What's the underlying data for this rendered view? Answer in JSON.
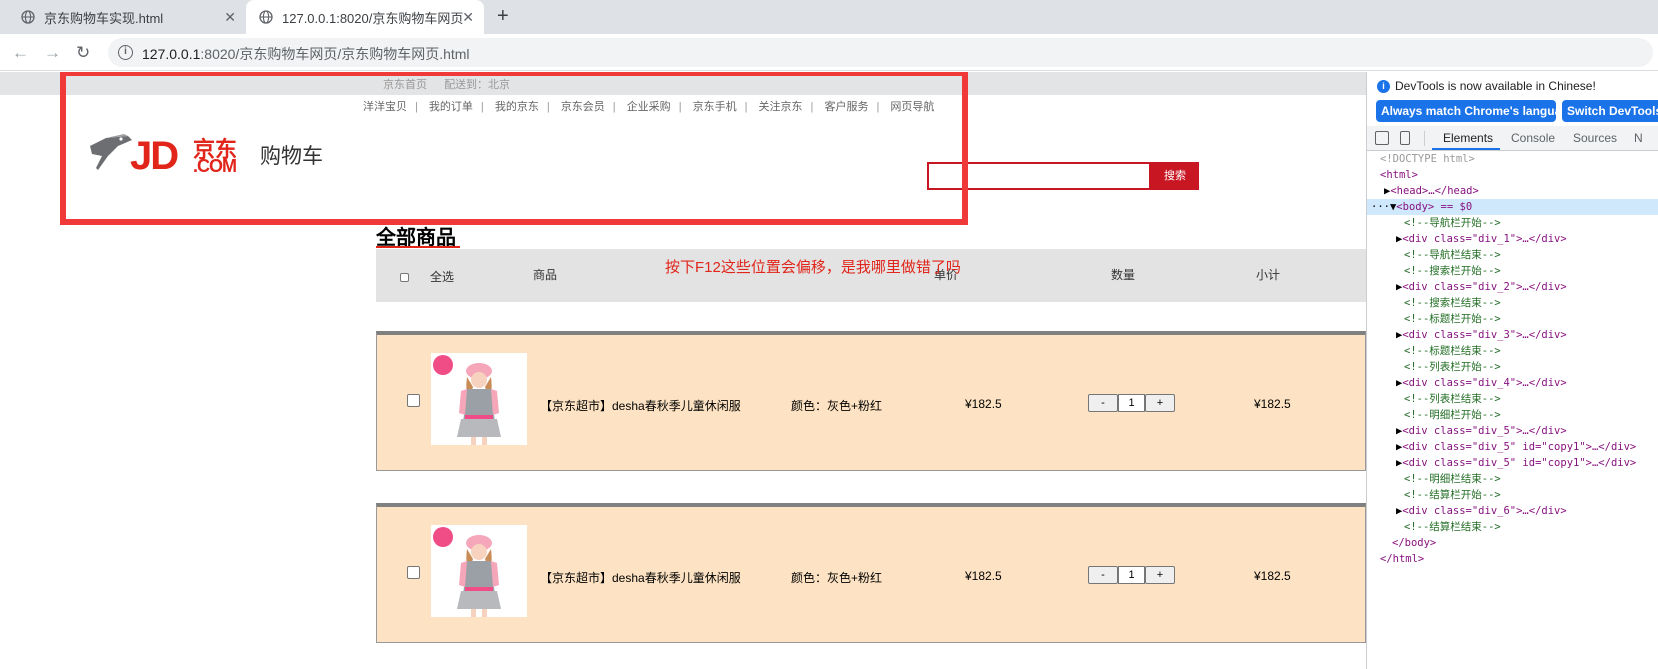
{
  "browser": {
    "tabs": [
      {
        "title": "京东购物车实现.html",
        "active": false
      },
      {
        "title": "127.0.0.1:8020/京东购物车网页",
        "active": true
      }
    ],
    "url_host": "127.0.0.1",
    "url_path": ":8020/京东购物车网页/京东购物车网页.html"
  },
  "page": {
    "topbar_links": [
      "京东首页",
      "配送到：北京"
    ],
    "shortcut_links": [
      "洋洋宝贝",
      "我的订单",
      "我的京东",
      "京东会员",
      "企业采购",
      "京东手机",
      "关注京东",
      "客户服务",
      "网页导航"
    ],
    "logo_jd": "JD",
    "logo_cn": "京东",
    "logo_com": ".COM",
    "cart_title": "购物车",
    "search_placeholder": "",
    "search_button": "搜索",
    "all_goods": "全部商品",
    "annotation": "按下F12这些位置会偏移，是我哪里做错了吗",
    "header": {
      "select_all": "全选",
      "product": "商品",
      "unit_price": "单价",
      "quantity": "数量",
      "subtotal": "小计"
    },
    "items": [
      {
        "name": "【京东超市】desha春秋季儿童休闲服",
        "spec": "颜色：灰色+粉红",
        "price": "¥182.5",
        "qty": "1",
        "subtotal": "¥182.5"
      },
      {
        "name": "【京东超市】desha春秋季儿童休闲服",
        "spec": "颜色：灰色+粉红",
        "price": "¥182.5",
        "qty": "1",
        "subtotal": "¥182.5"
      }
    ],
    "qty_minus": "-",
    "qty_plus": "+"
  },
  "devtools": {
    "notice": "DevTools is now available in Chinese!",
    "btn_match": "Always match Chrome's language",
    "btn_switch": "Switch DevTools",
    "tabs": [
      "Elements",
      "Console",
      "Sources",
      "N"
    ],
    "lines": [
      "<!DOCTYPE html>",
      "<html>",
      "<head>…</head>",
      "<body> == $0",
      "<!--导航栏开始-->",
      "<div class=\"div_1\">…</div>",
      "<!--导航栏结束-->",
      "<!--搜索栏开始-->",
      "<div class=\"div_2\">…</div>",
      "<!--搜索栏结束-->",
      "<!--标题栏开始-->",
      "<div class=\"div_3\">…</div>",
      "<!--标题栏结束-->",
      "<!--列表栏开始-->",
      "<div class=\"div_4\">…</div>",
      "<!--列表栏结束-->",
      "<!--明细栏开始-->",
      "<div class=\"div_5\">…</div>",
      "<div class=\"div_5\" id=\"copy1\">…</div>",
      "<div class=\"div_5\" id=\"copy1\">…</div>",
      "<!--明细栏结束-->",
      "<!--结算栏开始-->",
      "<div class=\"div_6\">…</div>",
      "<!--结算栏结束-->",
      "</body>",
      "</html>"
    ]
  },
  "colors": {
    "jd_red": "#e1251b",
    "annotation_frame": "#f03a3a",
    "item_bg": "#fde3c3",
    "devtools_blue": "#1a73e8"
  }
}
